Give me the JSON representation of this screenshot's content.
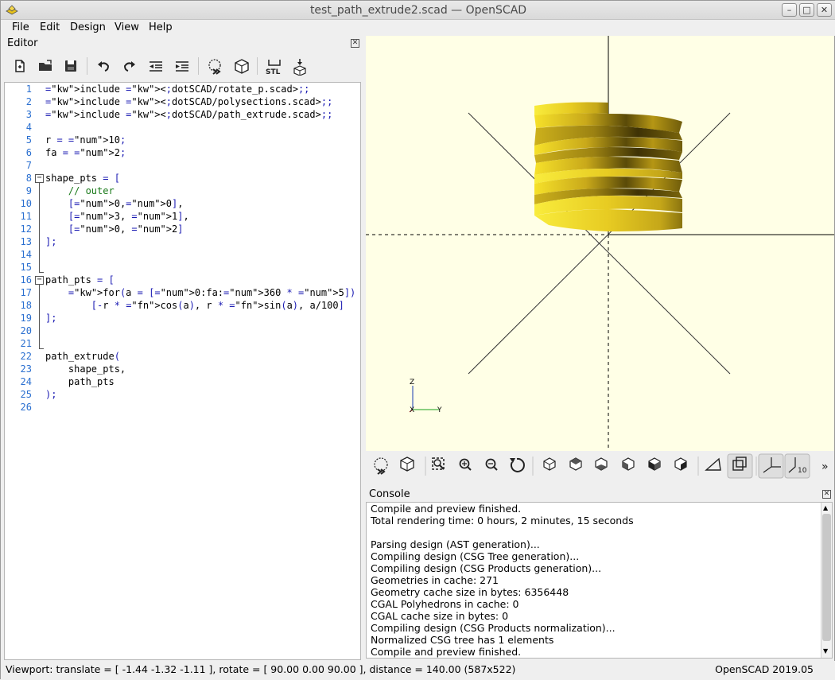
{
  "window": {
    "title": "test_path_extrude2.scad — OpenSCAD"
  },
  "menu": [
    "File",
    "Edit",
    "Design",
    "View",
    "Help"
  ],
  "editor": {
    "title": "Editor",
    "toolbar_icons": [
      "new-file-icon",
      "open-file-icon",
      "save-icon",
      "undo-icon",
      "redo-icon",
      "unindent-icon",
      "indent-icon",
      "preview-icon",
      "render-icon",
      "export-stl-icon",
      "send-to-3d-print-icon"
    ],
    "lines": [
      "include <dotSCAD/rotate_p.scad>;",
      "include <dotSCAD/polysections.scad>;",
      "include <dotSCAD/path_extrude.scad>;",
      "",
      "r = 10;",
      "fa = 2;",
      "",
      "shape_pts = [",
      "    // outer",
      "    [0,0],",
      "    [3, 1],",
      "    [0, 2]",
      "];",
      "",
      "",
      "path_pts = [",
      "    for(a = [0:fa:360 * 5])",
      "        [-r * cos(a), r * sin(a), a/100]",
      "];",
      "",
      "",
      "path_extrude(",
      "    shape_pts,",
      "    path_pts",
      ");",
      ""
    ]
  },
  "viewport": {
    "axis_labels": [
      "Z",
      "X",
      "Y"
    ],
    "scale_label": "10"
  },
  "console": {
    "title": "Console",
    "lines": [
      "Compile and preview finished.",
      "Total rendering time: 0 hours, 2 minutes, 15 seconds",
      "",
      "Parsing design (AST generation)...",
      "Compiling design (CSG Tree generation)...",
      "Compiling design (CSG Products generation)...",
      "Geometries in cache: 271",
      "Geometry cache size in bytes: 6356448",
      "CGAL Polyhedrons in cache: 0",
      "CGAL cache size in bytes: 0",
      "Compiling design (CSG Products normalization)...",
      "Normalized CSG tree has 1 elements",
      "Compile and preview finished."
    ]
  },
  "status": {
    "viewport": "Viewport: translate = [ -1.44 -1.32 -1.11 ], rotate = [ 90.00 0.00 90.00 ], distance = 140.00 (587x522)",
    "version": "OpenSCAD 2019.05"
  },
  "colors": {
    "viewport_bg": "#ffffe6",
    "model_yellow": "#f5e12a",
    "line_number": "#2a6fd0"
  }
}
